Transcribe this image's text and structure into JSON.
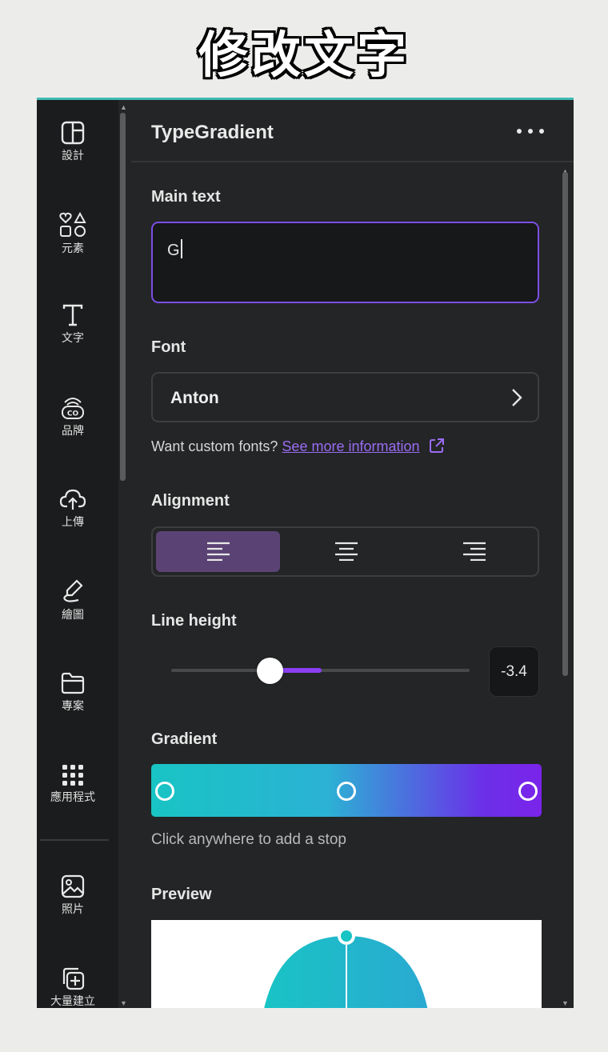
{
  "caption": "修改文字",
  "sidebar": {
    "items": [
      {
        "label": "設計",
        "icon": "layout-icon"
      },
      {
        "label": "元素",
        "icon": "shapes-icon"
      },
      {
        "label": "文字",
        "icon": "text-icon"
      },
      {
        "label": "品牌",
        "icon": "brand-icon"
      },
      {
        "label": "上傳",
        "icon": "cloud-upload-icon"
      },
      {
        "label": "繪圖",
        "icon": "draw-icon"
      },
      {
        "label": "專案",
        "icon": "folder-icon"
      },
      {
        "label": "應用程式",
        "icon": "apps-grid-icon"
      },
      {
        "label": "照片",
        "icon": "photo-icon"
      },
      {
        "label": "大量建立",
        "icon": "bulk-create-icon"
      }
    ]
  },
  "panel": {
    "title": "TypeGradient",
    "main_text": {
      "label": "Main text",
      "value": "G"
    },
    "font": {
      "label": "Font",
      "value": "Anton"
    },
    "custom_fonts": {
      "text": "Want custom fonts?",
      "link": "See more information"
    },
    "alignment": {
      "label": "Alignment",
      "options": [
        "left",
        "center",
        "right"
      ],
      "selected": "left"
    },
    "line_height": {
      "label": "Line height",
      "value": "-3.4"
    },
    "gradient": {
      "label": "Gradient",
      "hint": "Click anywhere to add a stop",
      "colors": [
        "#18c4c4",
        "#7a24ea"
      ],
      "stops": 3
    },
    "preview": {
      "label": "Preview"
    }
  },
  "colors": {
    "accent": "#7c4ee6",
    "link": "#9b6cf3",
    "panel_bg": "#232526"
  }
}
